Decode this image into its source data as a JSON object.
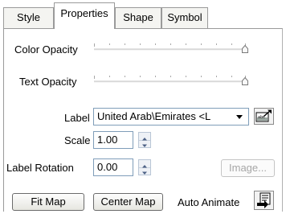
{
  "tabs": [
    {
      "label": "Style",
      "active": false
    },
    {
      "label": "Properties",
      "active": true
    },
    {
      "label": "Shape",
      "active": false
    },
    {
      "label": "Symbol",
      "active": false
    }
  ],
  "color_opacity": {
    "label": "Color Opacity",
    "value": 1.0
  },
  "text_opacity": {
    "label": "Text Opacity",
    "value": 1.0
  },
  "label_field": {
    "label": "Label",
    "value": "United Arab\\Emirates <L"
  },
  "scale_field": {
    "label": "Scale",
    "value": "1.00"
  },
  "rotation_field": {
    "label": "Label Rotation",
    "value": "0.00"
  },
  "buttons": {
    "image": "Image...",
    "fit_map": "Fit Map",
    "center_map": "Center Map"
  },
  "auto_animate": {
    "label": "Auto Animate"
  },
  "icons": {
    "label_editor": "label-editor-icon",
    "auto_animate": "auto-animate-icon",
    "dropdown": "chevron-down-icon"
  }
}
